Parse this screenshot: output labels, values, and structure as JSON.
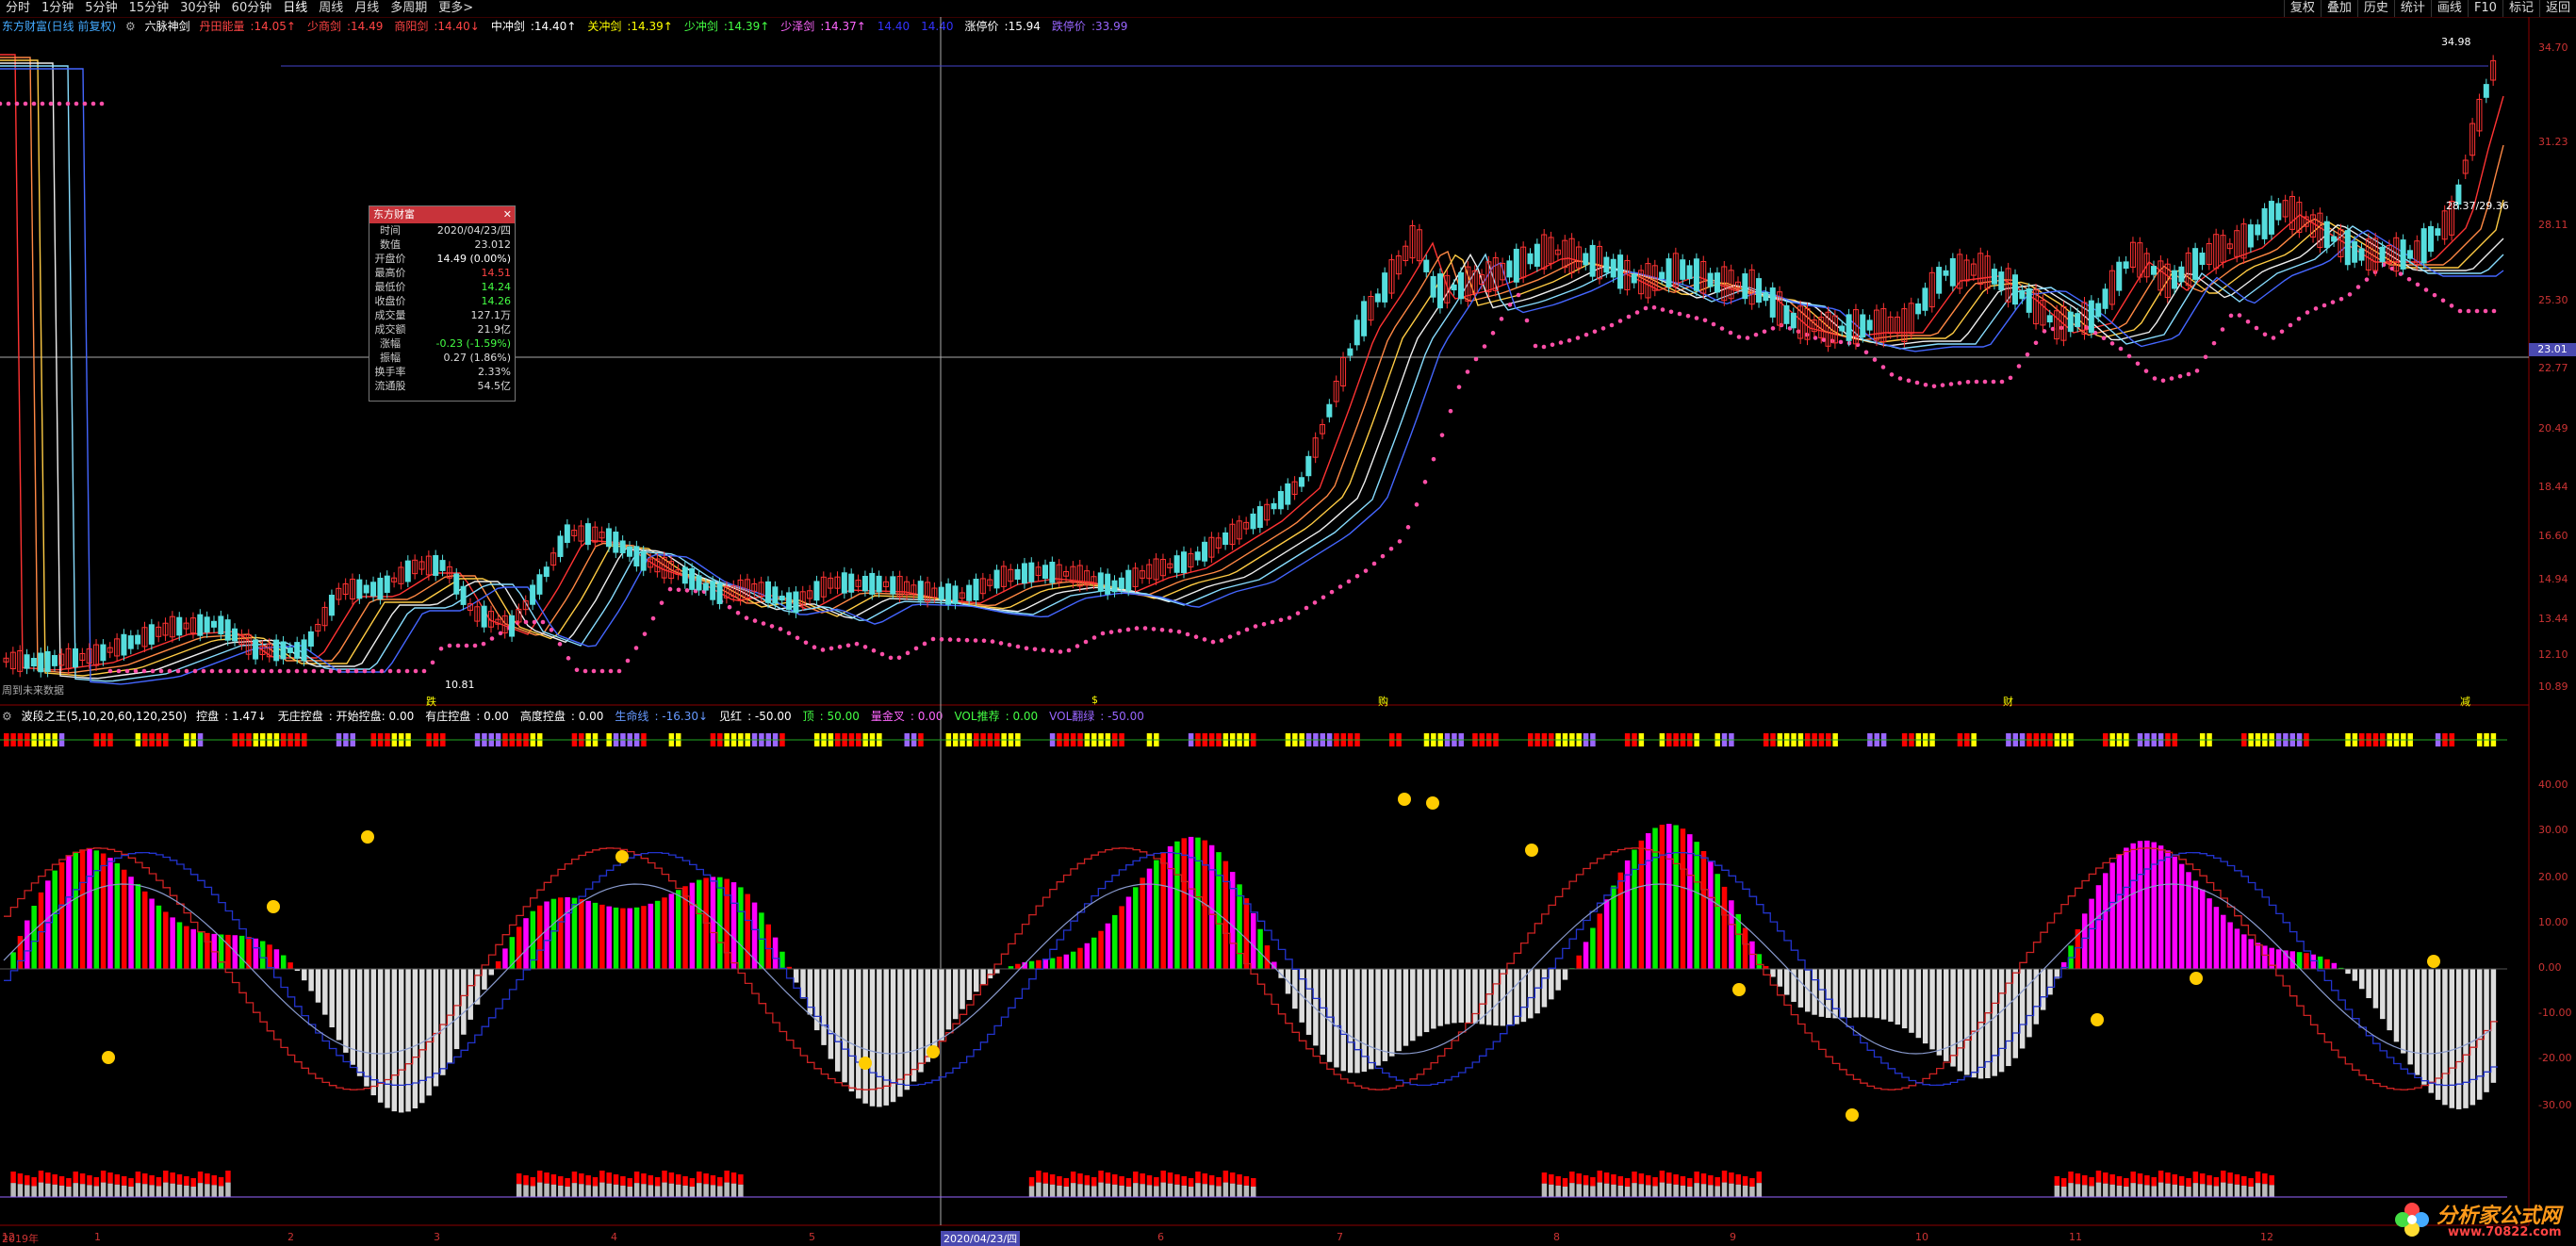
{
  "toolbar": {
    "periods": [
      "分时",
      "1分钟",
      "5分钟",
      "15分钟",
      "30分钟",
      "60分钟",
      "日线",
      "周线",
      "月线",
      "多周期",
      "更多>"
    ],
    "right_buttons": [
      "复权",
      "叠加",
      "历史",
      "统计",
      "画线",
      "F10",
      "标记",
      "返回"
    ]
  },
  "main_legend": {
    "stock": "东方财富(日线 前复权)",
    "indicator": "六脉神剑",
    "items": [
      {
        "label": "丹田能量",
        "value": "14.05↑",
        "color": "#ff4444"
      },
      {
        "label": "少商剑",
        "value": "14.49",
        "color": "#ff4444"
      },
      {
        "label": "商阳剑",
        "value": "14.40↓",
        "color": "#ff4444"
      },
      {
        "label": "中冲剑",
        "value": "14.40↑",
        "color": "#ffffff"
      },
      {
        "label": "关冲剑",
        "value": "14.39↑",
        "color": "#ffff00"
      },
      {
        "label": "少冲剑",
        "value": "14.39↑",
        "color": "#44ff44"
      },
      {
        "label": "少泽剑",
        "value": "14.37↑",
        "color": "#ff66ff"
      },
      {
        "label": "",
        "value": "14.40",
        "color": "#3333ff"
      },
      {
        "label": "",
        "value": "14.40",
        "color": "#3333ff"
      },
      {
        "label": "涨停价",
        "value": "15.94",
        "color": "#ffffff"
      },
      {
        "label": "跌停价",
        "value": "33.99",
        "color": "#9966ff"
      }
    ]
  },
  "infobox": {
    "title": "东方财富",
    "close": "✕",
    "rows": [
      {
        "k": "时间",
        "v": "2020/04/23/四",
        "c": "#dddddd"
      },
      {
        "k": "数值",
        "v": "23.012",
        "c": "#dddddd"
      },
      {
        "k": "开盘价",
        "v": "14.49 (0.00%)",
        "c": "#ffffff"
      },
      {
        "k": "最高价",
        "v": "14.51",
        "c": "#ff4444"
      },
      {
        "k": "最低价",
        "v": "14.24",
        "c": "#44ff44"
      },
      {
        "k": "收盘价",
        "v": "14.26",
        "c": "#44ff44"
      },
      {
        "k": "成交量",
        "v": "127.1万",
        "c": "#dddddd"
      },
      {
        "k": "成交额",
        "v": "21.9亿",
        "c": "#dddddd"
      },
      {
        "k": "涨幅",
        "v": "-0.23 (-1.59%)",
        "c": "#44ff44"
      },
      {
        "k": "振幅",
        "v": "0.27 (1.86%)",
        "c": "#dddddd"
      },
      {
        "k": "换手率",
        "v": "2.33%",
        "c": "#dddddd"
      },
      {
        "k": "流通股",
        "v": "54.5亿",
        "c": "#dddddd"
      }
    ]
  },
  "price_axis": {
    "ticks": [
      "34.70",
      "31.23",
      "28.11",
      "25.30",
      "22.77",
      "20.49",
      "18.44",
      "16.60",
      "14.94",
      "13.44",
      "12.10",
      "10.89"
    ],
    "cursor_value": "23.01",
    "high_label": "34.98",
    "mid_label": "28.37/29.36",
    "low_label": "10.81"
  },
  "main_notes": {
    "bottom_left": "周到未来数据",
    "markers": [
      "跌",
      "$",
      "购",
      "财",
      "减"
    ]
  },
  "sub_legend": {
    "name": "波段之王(5,10,20,60,120,250)",
    "items": [
      {
        "label": "控盘",
        "value": "1.47↓",
        "color": "#ffffff"
      },
      {
        "label": "无庄控盘",
        "value": "开始控盘: 0.00",
        "color": "#ffffff"
      },
      {
        "label": "有庄控盘",
        "value": "0.00",
        "color": "#ffffff"
      },
      {
        "label": "高度控盘",
        "value": "0.00",
        "color": "#ffffff"
      },
      {
        "label": "生命线",
        "value": "-16.30↓",
        "color": "#6699ff"
      },
      {
        "label": "见红",
        "value": "-50.00",
        "color": "#ffffff"
      },
      {
        "label": "顶",
        "value": "50.00",
        "color": "#44ff44"
      },
      {
        "label": "量金叉",
        "value": "0.00",
        "color": "#ff66ff"
      },
      {
        "label": "VOL推荐",
        "value": "0.00",
        "color": "#44ff44"
      },
      {
        "label": "VOL翻绿",
        "value": "-50.00",
        "color": "#9966ff"
      }
    ],
    "axis_ticks": [
      "40.00",
      "30.00",
      "20.00",
      "10.00",
      "0.00",
      "-10.00",
      "-20.00",
      "-30.00"
    ]
  },
  "date_axis": {
    "labels": [
      "2019年",
      "12",
      "1",
      "2",
      "3",
      "4",
      "5",
      "6",
      "7",
      "8",
      "9",
      "10",
      "11",
      "12"
    ],
    "cursor_date": "2020/04/23/四"
  },
  "watermark": {
    "text": "分析家公式网",
    "url": "www.70822.com"
  }
}
